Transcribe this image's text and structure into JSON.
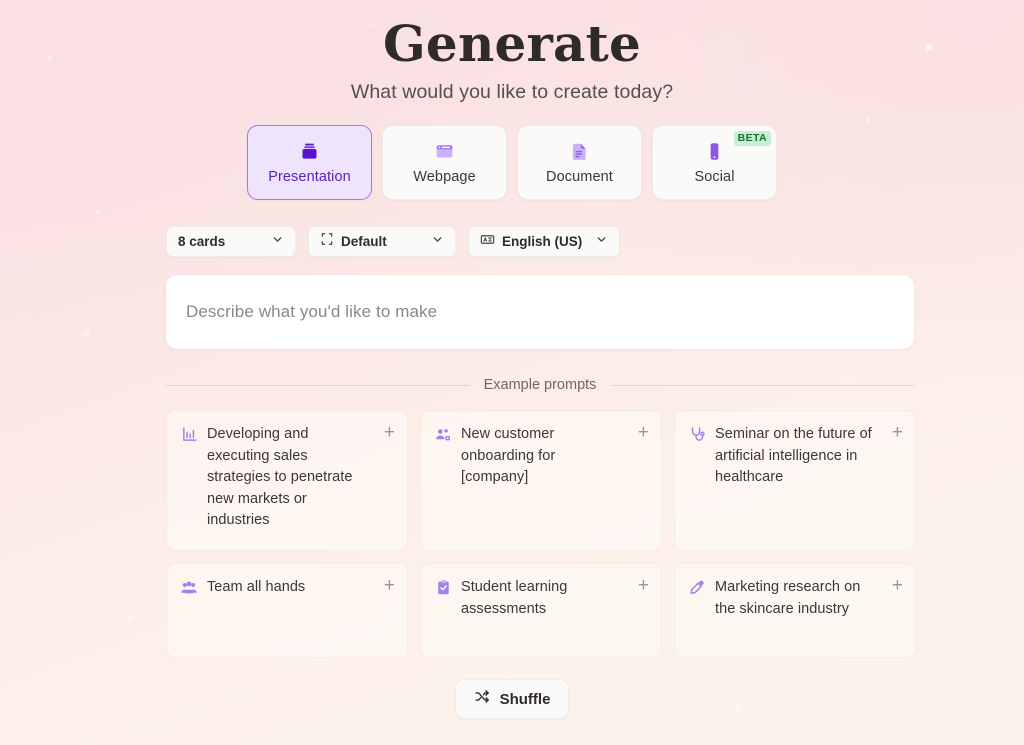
{
  "header": {
    "title": "Generate",
    "subtitle": "What would you like to create today?"
  },
  "tabs": [
    {
      "label": "Presentation",
      "icon": "presentation-icon",
      "selected": true,
      "badge": ""
    },
    {
      "label": "Webpage",
      "icon": "webpage-icon",
      "selected": false,
      "badge": ""
    },
    {
      "label": "Document",
      "icon": "document-icon",
      "selected": false,
      "badge": ""
    },
    {
      "label": "Social",
      "icon": "social-icon",
      "selected": false,
      "badge": "BETA"
    }
  ],
  "options": [
    {
      "label": "8 cards",
      "icon": "",
      "chevron": "chevron-down-icon"
    },
    {
      "label": "Default",
      "icon": "frame-icon",
      "chevron": "chevron-down-icon"
    },
    {
      "label": "English (US)",
      "icon": "translate-icon",
      "chevron": "chevron-down-icon"
    }
  ],
  "prompt": {
    "value": "",
    "placeholder": "Describe what you'd like to make"
  },
  "examples": {
    "divider_label": "Example prompts",
    "cards": [
      {
        "text": "Developing and executing sales strategies to penetrate new markets or industries",
        "icon": "bar-chart-icon",
        "add": "+"
      },
      {
        "text": "New customer onboarding for [company]",
        "icon": "user-group-icon",
        "add": "+"
      },
      {
        "text": "Seminar on the future of artificial intelligence in healthcare",
        "icon": "stethoscope-icon",
        "add": "+"
      },
      {
        "text": "Team all hands",
        "icon": "users-icon",
        "add": "+"
      },
      {
        "text": "Student learning assessments",
        "icon": "clipboard-check-icon",
        "add": "+"
      },
      {
        "text": "Marketing research on the skincare industry",
        "icon": "dropper-icon",
        "add": "+"
      }
    ]
  },
  "shuffle": {
    "label": "Shuffle",
    "icon": "shuffle-icon"
  },
  "colors": {
    "accent_purple": "#5a21c0",
    "icon_purple": "#a77ef0",
    "selected_tab_bg": "#eee4fd",
    "selected_tab_border": "#a974f0",
    "beta_bg": "#c7efd2",
    "beta_text": "#1f6b3a",
    "card_bg": "#fbfaf8",
    "page_bg_start": "#f9dee4",
    "page_bg_end": "#fdf3ec"
  }
}
